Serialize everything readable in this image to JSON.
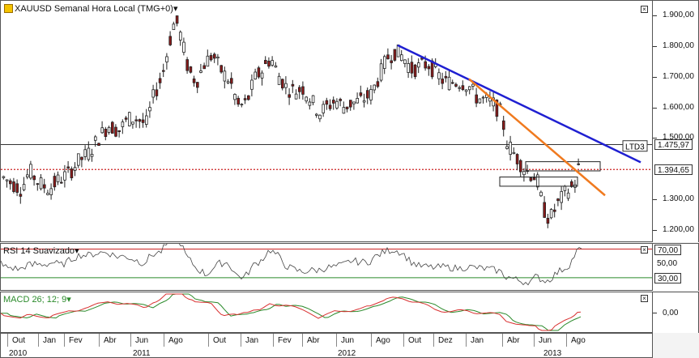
{
  "main": {
    "title": "XAUUSD Semanal Hora Local (TMG+0)",
    "dropdown_glyph": "▾",
    "ticks": [
      "1.900,00",
      "1.800,00",
      "1.700,00",
      "1.600,00",
      "1.500,00",
      "1.300,00",
      "1.200,00"
    ],
    "tick_values": [
      1900,
      1800,
      1700,
      1600,
      1500,
      1300,
      1200
    ],
    "price_tags": {
      "ltd3_label": "LTD3",
      "ltd3_value": "1.475,97",
      "current_value": "1.394,65"
    },
    "y_range": [
      1160,
      1945
    ]
  },
  "rsi": {
    "title": "RSI 14 Suavizado",
    "dropdown_glyph": "▾",
    "levels": [
      "70,00",
      "50,00",
      "30,00"
    ],
    "level_values": [
      70,
      50,
      30
    ]
  },
  "macd": {
    "title": "MACD 26; 12; 9",
    "dropdown_glyph": "▾",
    "ticks": [
      "0,00"
    ]
  },
  "xaxis": {
    "months": [
      "Out",
      "Jan",
      "Fev",
      "Abr",
      "Jun",
      "Ago",
      "Out",
      "Jan",
      "Fev",
      "Abr",
      "Jun",
      "Ago",
      "Out",
      "Dez",
      "Jan",
      "Abr",
      "Jun",
      "Ago"
    ],
    "years": [
      "2010",
      "2011",
      "2012",
      "2013"
    ]
  },
  "colors": {
    "bull": "#ffffff",
    "bear": "#8b1a1a",
    "trend_blue": "#1f1fd1",
    "trend_orange": "#f07a1f",
    "support_red": "#cc2222",
    "rsi_line": "#444444",
    "macd_red": "#d93030",
    "macd_green": "#2a8a2a"
  },
  "icons": {
    "close": "close-icon",
    "logo": "xauusd-logo-icon"
  }
}
